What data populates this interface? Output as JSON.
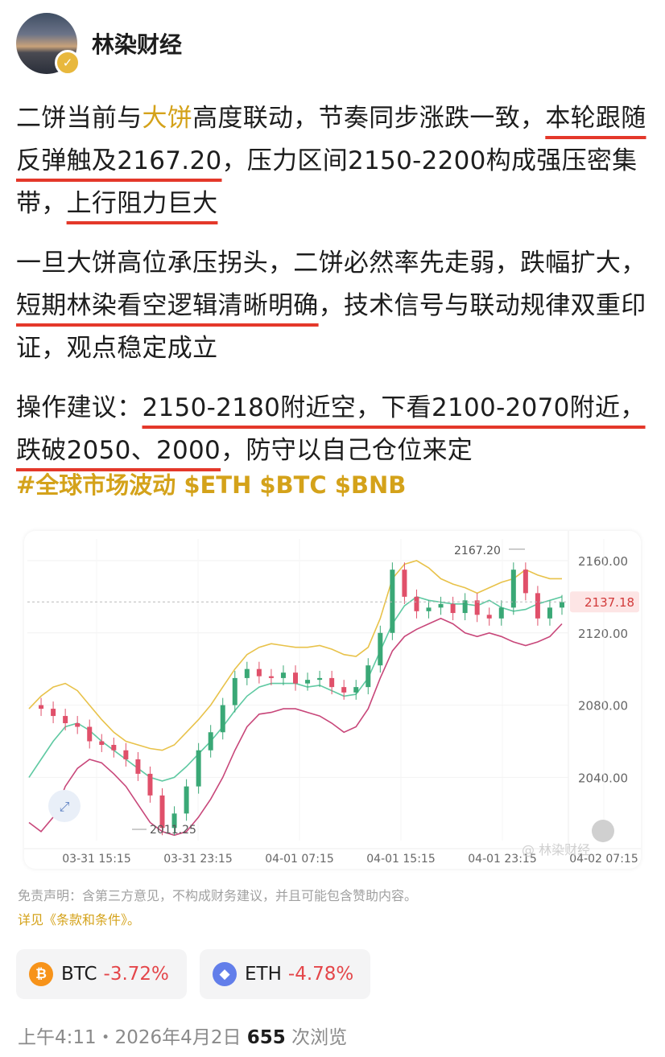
{
  "author": {
    "name": "林染财经"
  },
  "post": {
    "p1": {
      "a": "二饼当前与",
      "b": "大饼",
      "c": "高度联动，节奏同步涨跌一致，",
      "d": "本轮跟随反弹触及2167.20",
      "e": "，压力区间2150-2200构成强压密集带，",
      "f": "上行阻力巨大"
    },
    "p2": {
      "a": "一旦大饼高位承压拐头，二饼必然率先走弱，跌幅扩大，",
      "b": "短期林染看空逻辑清晰明确",
      "c": "，技术信号与联动规律双重印证，观点稳定成立"
    },
    "p3": {
      "a": "操作建议：",
      "b": "2150-2180附近空，下看2100-2070附近，跌破2050、2000",
      "c": "，防守以自己仓位来定"
    },
    "tags": [
      "#全球市场波动",
      "$ETH",
      "$BTC",
      "$BNB"
    ]
  },
  "chart_data": {
    "type": "line",
    "title": "",
    "x_labels": [
      "03-31 15:15",
      "03-31 23:15",
      "04-01 07:15",
      "04-01 15:15",
      "04-01 23:15",
      "04-02 07:15"
    ],
    "y_ticks": [
      2040,
      2080,
      2120,
      2160
    ],
    "y_tick_labels": [
      "2040.00",
      "2080.00",
      "2120.00",
      "2160.00"
    ],
    "ylim": [
      2005,
      2172
    ],
    "current_price": 2137.18,
    "current_price_label": "2137.18",
    "high_label": "2167.20",
    "high_value": 2167.2,
    "low_label": "2011.25",
    "low_value": 2011.25,
    "watermark": "@ 林染财经",
    "series": [
      {
        "color": "#e8c24a",
        "values": [
          2078,
          2085,
          2090,
          2092,
          2088,
          2080,
          2072,
          2065,
          2060,
          2058,
          2056,
          2055,
          2058,
          2065,
          2072,
          2080,
          2090,
          2100,
          2108,
          2112,
          2114,
          2113,
          2112,
          2112,
          2113,
          2111,
          2108,
          2107,
          2112,
          2128,
          2150,
          2158,
          2160,
          2156,
          2150,
          2147,
          2145,
          2142,
          2145,
          2148,
          2150,
          2155,
          2152,
          2150,
          2150
        ]
      },
      {
        "color": "#5fc9a2",
        "values": [
          2040,
          2050,
          2060,
          2068,
          2070,
          2066,
          2060,
          2055,
          2050,
          2045,
          2040,
          2038,
          2040,
          2046,
          2053,
          2060,
          2068,
          2077,
          2085,
          2090,
          2092,
          2092,
          2092,
          2090,
          2091,
          2088,
          2085,
          2086,
          2095,
          2110,
          2125,
          2135,
          2140,
          2138,
          2137,
          2136,
          2136,
          2135,
          2138,
          2134,
          2132,
          2133,
          2136,
          2138,
          2140
        ]
      },
      {
        "color": "#c8477a",
        "values": [
          2015,
          2010,
          2018,
          2035,
          2045,
          2050,
          2048,
          2042,
          2035,
          2025,
          2015,
          2010,
          2008,
          2010,
          2018,
          2028,
          2040,
          2055,
          2068,
          2075,
          2076,
          2078,
          2078,
          2076,
          2074,
          2070,
          2065,
          2068,
          2078,
          2095,
          2110,
          2118,
          2122,
          2125,
          2128,
          2125,
          2120,
          2118,
          2120,
          2118,
          2115,
          2113,
          2115,
          2118,
          2125
        ]
      },
      {
        "name": "price",
        "color": "#3aa876",
        "values": [
          2080,
          2078,
          2074,
          2070,
          2068,
          2060,
          2058,
          2055,
          2050,
          2042,
          2030,
          2012,
          2020,
          2035,
          2055,
          2065,
          2080,
          2095,
          2100,
          2096,
          2095,
          2098,
          2092,
          2094,
          2095,
          2090,
          2087,
          2090,
          2102,
          2120,
          2155,
          2140,
          2132,
          2134,
          2136,
          2131,
          2138,
          2130,
          2128,
          2134,
          2155,
          2142,
          2128,
          2134,
          2137
        ]
      }
    ],
    "grid": true
  },
  "disclaimer": "免责声明：含第三方意见，不构成财务建议，并且可能包含赞助内容。",
  "terms": "详见《条款和条件》。",
  "coins": [
    {
      "symbol": "BTC",
      "change": "-3.72%",
      "icon": "bitcoin-icon",
      "color": "#f7931a"
    },
    {
      "symbol": "ETH",
      "change": "-4.78%",
      "icon": "ethereum-icon",
      "color": "#627eea"
    }
  ],
  "meta": {
    "time": "上午4:11・2026年4月2日",
    "views": "655",
    "views_label": "次浏览"
  }
}
